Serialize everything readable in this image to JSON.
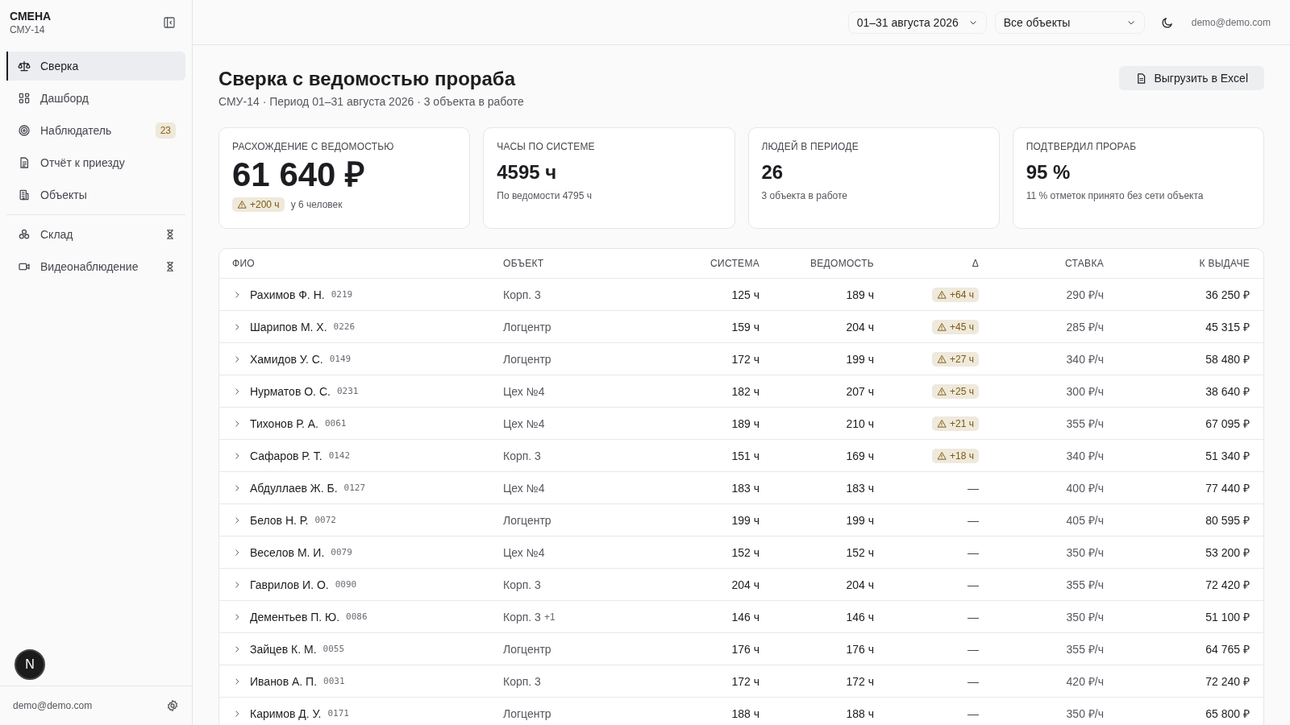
{
  "sidebar": {
    "brand": "СМЕНА",
    "org": "СМУ-14",
    "items": [
      {
        "label": "Сверка",
        "selected": true
      },
      {
        "label": "Дашборд",
        "selected": false
      },
      {
        "label": "Наблюдатель",
        "selected": false,
        "badge": "23"
      },
      {
        "label": "Отчёт к приезду",
        "selected": false
      },
      {
        "label": "Объекты",
        "selected": false
      }
    ],
    "secondary_items": [
      {
        "label": "Склад",
        "selected": false,
        "pending": true
      },
      {
        "label": "Видеонаблюдение",
        "selected": false,
        "pending": true
      }
    ],
    "user_email": "demo@demo.com",
    "dev_badge": "N"
  },
  "topbar": {
    "period": "01–31 августа 2026",
    "objects_filter": "Все объекты",
    "email": "demo@demo.com"
  },
  "page": {
    "title": "Сверка с ведомостью прораба",
    "subtitle": "СМУ-14 · Период 01–31 августа 2026 · 3 объекта в работе",
    "export_button": "Выгрузить в Excel"
  },
  "cards": [
    {
      "label": "РАСХОЖДЕНИЕ С ВЕДОМОСТЬЮ",
      "value": "61 640 ₽",
      "kind": "alert",
      "badge": "+200 ч",
      "note": "у 6 человек"
    },
    {
      "label": "ЧАСЫ ПО СИСТЕМЕ",
      "value": "4595 ч",
      "kind": "plain",
      "note": "По ведомости 4795 ч"
    },
    {
      "label": "ЛЮДЕЙ В ПЕРИОДЕ",
      "value": "26",
      "kind": "plain",
      "note": "3 объекта в работе"
    },
    {
      "label": "ПОДТВЕРДИЛ ПРОРАБ",
      "value": "95 %",
      "kind": "plain",
      "note": "11 % отметок принято без сети объекта"
    }
  ],
  "table": {
    "columns": [
      "ФИО",
      "ОБЪЕКТ",
      "СИСТЕМА",
      "ВЕДОМОСТЬ",
      "Δ",
      "СТАВКА",
      "К ВЫДАЧЕ"
    ],
    "rows": [
      {
        "name": "Рахимов Ф. Н.",
        "code": "0219",
        "object": "Корп. 3",
        "system": "125 ч",
        "sheet": "189 ч",
        "delta": "+64 ч",
        "kind": "warn",
        "rate": "290 ₽/ч",
        "payout": "36 250 ₽",
        "expanded": false
      },
      {
        "name": "Шарипов М. Х.",
        "code": "0226",
        "object": "Логцентр",
        "system": "159 ч",
        "sheet": "204 ч",
        "delta": "+45 ч",
        "kind": "warn",
        "rate": "285 ₽/ч",
        "payout": "45 315 ₽",
        "expanded": false
      },
      {
        "name": "Хамидов У. С.",
        "code": "0149",
        "object": "Логцентр",
        "system": "172 ч",
        "sheet": "199 ч",
        "delta": "+27 ч",
        "kind": "warn",
        "rate": "340 ₽/ч",
        "payout": "58 480 ₽",
        "expanded": false
      },
      {
        "name": "Нурматов О. С.",
        "code": "0231",
        "object": "Цех №4",
        "system": "182 ч",
        "sheet": "207 ч",
        "delta": "+25 ч",
        "kind": "warn",
        "rate": "300 ₽/ч",
        "payout": "38 640 ₽",
        "expanded": false
      },
      {
        "name": "Тихонов Р. А.",
        "code": "0061",
        "object": "Цех №4",
        "system": "189 ч",
        "sheet": "210 ч",
        "delta": "+21 ч",
        "kind": "warn",
        "rate": "355 ₽/ч",
        "payout": "67 095 ₽",
        "expanded": false
      },
      {
        "name": "Сафаров Р. Т.",
        "code": "0142",
        "object": "Корп. 3",
        "system": "151 ч",
        "sheet": "169 ч",
        "delta": "+18 ч",
        "kind": "warn",
        "rate": "340 ₽/ч",
        "payout": "51 340 ₽",
        "expanded": false
      },
      {
        "name": "Абдуллаев Ж. Б.",
        "code": "0127",
        "object": "Цех №4",
        "system": "183 ч",
        "sheet": "183 ч",
        "delta": "—",
        "kind": "none",
        "rate": "400 ₽/ч",
        "payout": "77 440 ₽",
        "expanded": false
      },
      {
        "name": "Белов Н. Р.",
        "code": "0072",
        "object": "Логцентр",
        "system": "199 ч",
        "sheet": "199 ч",
        "delta": "—",
        "kind": "none",
        "rate": "405 ₽/ч",
        "payout": "80 595 ₽",
        "expanded": false
      },
      {
        "name": "Веселов М. И.",
        "code": "0079",
        "object": "Цех №4",
        "system": "152 ч",
        "sheet": "152 ч",
        "delta": "—",
        "kind": "none",
        "rate": "350 ₽/ч",
        "payout": "53 200 ₽",
        "expanded": false
      },
      {
        "name": "Гаврилов И. О.",
        "code": "0090",
        "object": "Корп. 3",
        "system": "204 ч",
        "sheet": "204 ч",
        "delta": "—",
        "kind": "none",
        "rate": "355 ₽/ч",
        "payout": "72 420 ₽",
        "expanded": false
      },
      {
        "name": "Дементьев П. Ю.",
        "code": "0086",
        "object": "Корп. 3",
        "object_extra": "+1",
        "system": "146 ч",
        "sheet": "146 ч",
        "delta": "—",
        "kind": "none",
        "rate": "350 ₽/ч",
        "payout": "51 100 ₽",
        "expanded": false
      },
      {
        "name": "Зайцев К. М.",
        "code": "0055",
        "object": "Логцентр",
        "system": "176 ч",
        "sheet": "176 ч",
        "delta": "—",
        "kind": "none",
        "rate": "355 ₽/ч",
        "payout": "64 765 ₽",
        "expanded": false
      },
      {
        "name": "Иванов А. П.",
        "code": "0031",
        "object": "Корп. 3",
        "system": "172 ч",
        "sheet": "172 ч",
        "delta": "—",
        "kind": "none",
        "rate": "420 ₽/ч",
        "payout": "72 240 ₽",
        "expanded": false
      },
      {
        "name": "Каримов Д. У.",
        "code": "0171",
        "object": "Логцентр",
        "system": "188 ч",
        "sheet": "188 ч",
        "delta": "—",
        "kind": "none",
        "rate": "350 ₽/ч",
        "payout": "65 800 ₽",
        "expanded": false
      }
    ]
  }
}
